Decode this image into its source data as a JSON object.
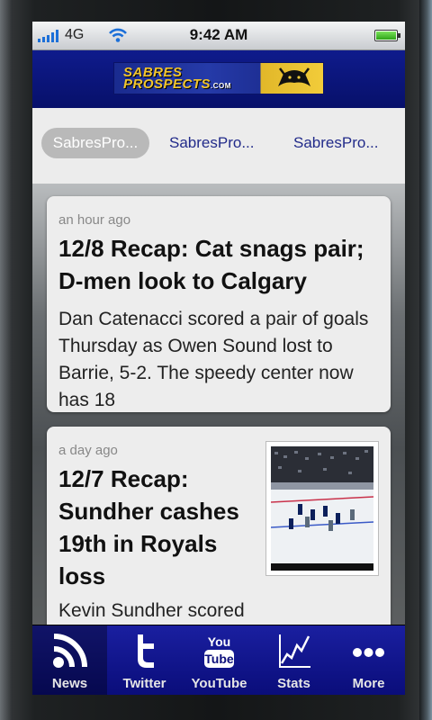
{
  "status_bar": {
    "carrier": "4G",
    "time": "9:42 AM",
    "icons": [
      "signal-bars-icon",
      "wifi-icon",
      "battery-icon"
    ]
  },
  "header": {
    "logo_line1": "SABRES",
    "logo_line2": "PROSPECTS",
    "logo_suffix": ".COM",
    "colors": {
      "header_bg": "#0a1380",
      "logo_gold": "#f2cc3a"
    }
  },
  "feed_tabs": [
    {
      "label": "SabresPro...",
      "selected": true
    },
    {
      "label": "SabresPro...",
      "selected": false
    },
    {
      "label": "SabresPro...",
      "selected": false
    }
  ],
  "articles": [
    {
      "time_ago": "an hour ago",
      "headline": "12/8 Recap: Cat snags pair; D-men look to Calgary",
      "summary": "Dan Catenacci scored a pair of goals Thursday as Owen Sound lost to Barrie, 5-2. The speedy center now has 18"
    },
    {
      "time_ago": "a day ago",
      "headline": "12/7 Recap: Sundher cashes 19th in Royals loss",
      "summary": "Kevin Sundher scored",
      "thumbnail": "hockey-game-photo"
    }
  ],
  "bottom_tabs": [
    {
      "label": "News",
      "icon": "rss-icon",
      "active": true
    },
    {
      "label": "Twitter",
      "icon": "twitter-icon",
      "active": false
    },
    {
      "label": "YouTube",
      "icon": "youtube-icon",
      "icon_text_top": "You",
      "icon_text_bottom": "Tube",
      "active": false
    },
    {
      "label": "Stats",
      "icon": "stats-chart-icon",
      "active": false
    },
    {
      "label": "More",
      "icon": "more-dots-icon",
      "active": false
    }
  ]
}
